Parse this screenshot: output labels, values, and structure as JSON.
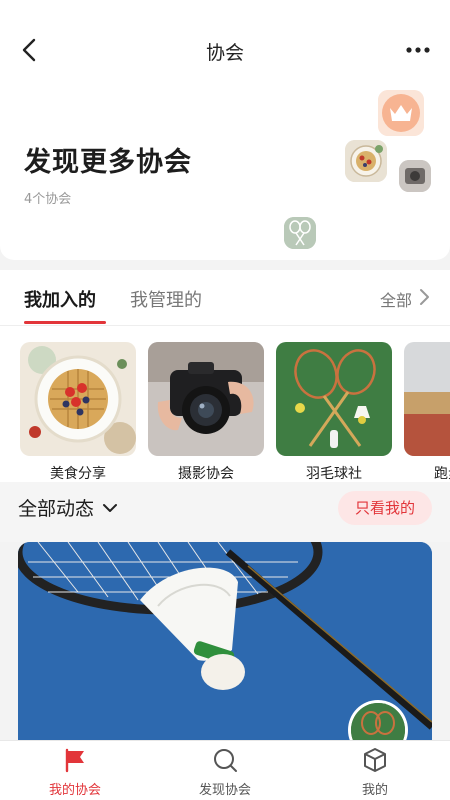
{
  "header": {
    "title": "协会"
  },
  "hero": {
    "title": "发现更多协会",
    "count_text": "4个协会"
  },
  "tabs": {
    "joined": "我加入的",
    "managed": "我管理的",
    "see_all": "全部"
  },
  "associations": [
    {
      "name": "美食分享"
    },
    {
      "name": "摄影协会"
    },
    {
      "name": "羽毛球社"
    },
    {
      "name": "跑步协会"
    }
  ],
  "feed": {
    "filter_label": "全部动态",
    "only_mine_label": "只看我的"
  },
  "bottom_nav": [
    {
      "label": "我的协会",
      "icon": "flag-icon",
      "active": true
    },
    {
      "label": "发现协会",
      "icon": "discover-search-icon",
      "active": false
    },
    {
      "label": "我的",
      "icon": "cube-icon",
      "active": false
    }
  ],
  "colors": {
    "accent": "#e2353a",
    "accent_bg": "#fde6e6"
  }
}
